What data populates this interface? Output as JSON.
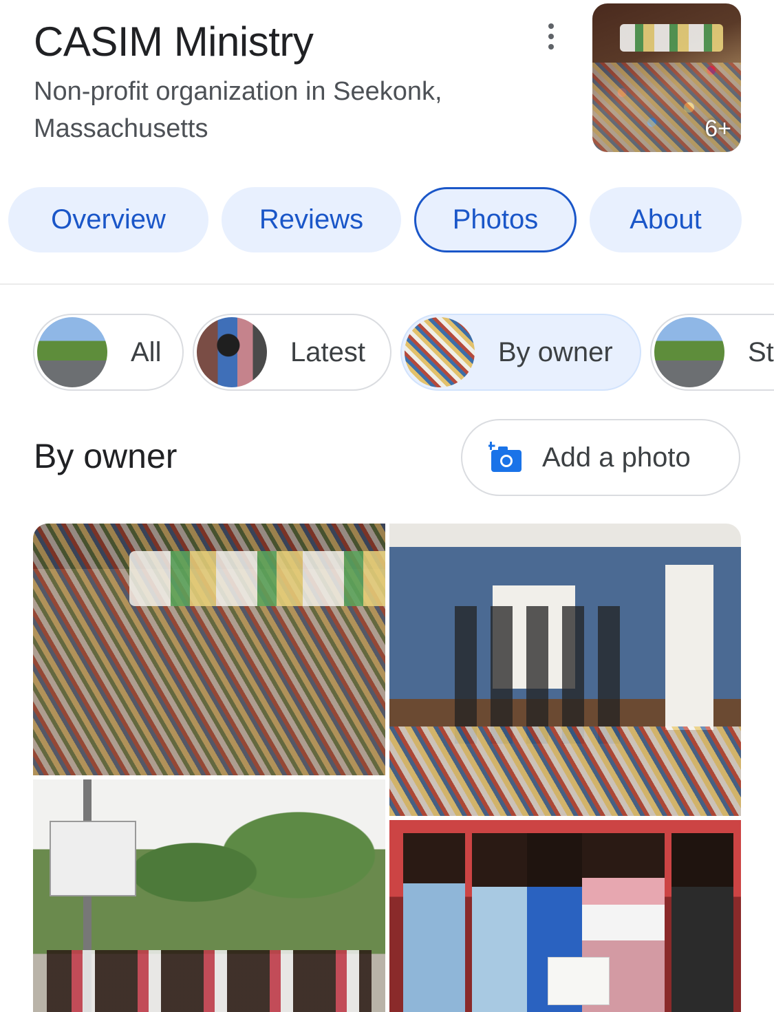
{
  "header": {
    "title": "CASIM Ministry",
    "subtitle": "Non-profit organization in Seekonk, Massachusetts",
    "hero_photo_count": "6+",
    "more_icon": "more-vert-icon"
  },
  "tabs": [
    {
      "label": "Overview",
      "active": false
    },
    {
      "label": "Reviews",
      "active": false
    },
    {
      "label": "Photos",
      "active": true
    },
    {
      "label": "About",
      "active": false
    }
  ],
  "photo_filters": [
    {
      "label": "All",
      "active": false
    },
    {
      "label": "Latest",
      "active": false
    },
    {
      "label": "By owner",
      "active": true
    },
    {
      "label": "St",
      "active": false
    }
  ],
  "section": {
    "title": "By owner",
    "add_photo_label": "Add a photo",
    "add_photo_icon": "add-photo-camera-icon"
  },
  "colors": {
    "accent": "#1a56c8",
    "chip_active_bg": "#e8f0fe",
    "text_primary": "#202124",
    "text_secondary": "#4d5156"
  }
}
